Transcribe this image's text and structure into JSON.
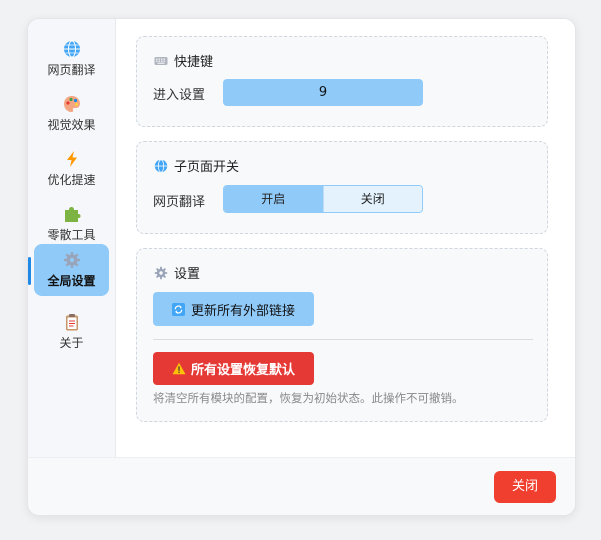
{
  "sidebar": {
    "items": [
      {
        "label": "网页翻译",
        "icon": "globe-icon"
      },
      {
        "label": "视觉效果",
        "icon": "palette-icon"
      },
      {
        "label": "优化提速",
        "icon": "lightning-icon"
      },
      {
        "label": "零散工具",
        "icon": "puzzle-icon"
      },
      {
        "label": "全局设置",
        "icon": "gear-icon",
        "active": true
      },
      {
        "label": "关于",
        "icon": "clipboard-icon"
      }
    ]
  },
  "shortcut": {
    "title": "快捷键",
    "label": "进入设置",
    "value": "9"
  },
  "subpage": {
    "title": "子页面开关",
    "label": "网页翻译",
    "on_label": "开启",
    "off_label": "关闭",
    "selected": "开启"
  },
  "settings": {
    "title": "设置",
    "update_label": "更新所有外部链接",
    "reset_label": "所有设置恢复默认",
    "reset_note": "将清空所有模块的配置，恢复为初始状态。此操作不可撤销。"
  },
  "footer": {
    "close_label": "关闭"
  },
  "colors": {
    "accent": "#90caf9",
    "active_indicator": "#1e88e5",
    "danger": "#e53935",
    "close_button": "#f03e2f"
  }
}
